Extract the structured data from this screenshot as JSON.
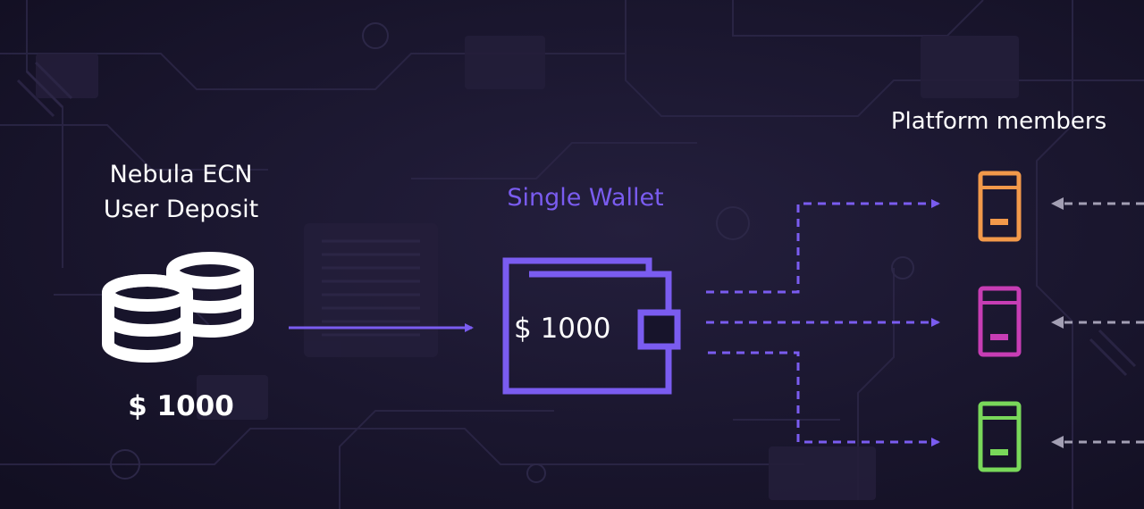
{
  "source": {
    "title_line1": "Nebula ECN",
    "title_line2": "User Deposit",
    "amount": "$ 1000",
    "icon": "coins-stack-icon"
  },
  "wallet": {
    "title": "Single Wallet",
    "amount": "$ 1000",
    "icon": "wallet-icon"
  },
  "members": {
    "title": "Platform members",
    "items": [
      {
        "icon": "member-device-icon",
        "color": "#f2994a"
      },
      {
        "icon": "member-device-icon",
        "color": "#c73db4"
      },
      {
        "icon": "member-device-icon",
        "color": "#79d85a"
      }
    ]
  },
  "colors": {
    "accent": "#7a5cf0",
    "background": "#17142b",
    "incoming_arrow": "#a39fb4"
  }
}
